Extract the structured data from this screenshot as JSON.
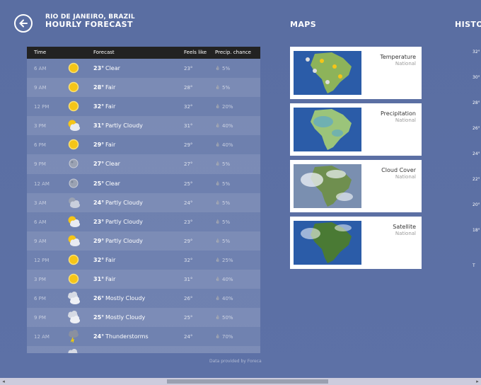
{
  "header": {
    "location": "RIO DE JANEIRO, BRAZIL",
    "title": "HOURLY FORECAST",
    "maps_title": "MAPS",
    "history_title": "HISTOR"
  },
  "table": {
    "columns": [
      "Time",
      "Forecast",
      "Feels like",
      "Precip. chance"
    ],
    "rows": [
      {
        "time": "6 AM",
        "icon": "sun",
        "temp": "23°",
        "cond": "Clear",
        "feels": "23°",
        "precip": "5%"
      },
      {
        "time": "9 AM",
        "icon": "sun",
        "temp": "28°",
        "cond": "Fair",
        "feels": "28°",
        "precip": "5%"
      },
      {
        "time": "12 PM",
        "icon": "sun",
        "temp": "32°",
        "cond": "Fair",
        "feels": "32°",
        "precip": "20%"
      },
      {
        "time": "3 PM",
        "icon": "partly",
        "temp": "31°",
        "cond": "Partly Cloudy",
        "feels": "31°",
        "precip": "40%"
      },
      {
        "time": "6 PM",
        "icon": "sun",
        "temp": "29°",
        "cond": "Fair",
        "feels": "29°",
        "precip": "40%"
      },
      {
        "time": "9 PM",
        "icon": "moon",
        "temp": "27°",
        "cond": "Clear",
        "feels": "27°",
        "precip": "5%"
      },
      {
        "time": "12 AM",
        "icon": "moon",
        "temp": "25°",
        "cond": "Clear",
        "feels": "25°",
        "precip": "5%"
      },
      {
        "time": "3 AM",
        "icon": "moon-cloud",
        "temp": "24°",
        "cond": "Partly Cloudy",
        "feels": "24°",
        "precip": "5%"
      },
      {
        "time": "6 AM",
        "icon": "partly",
        "temp": "23°",
        "cond": "Partly Cloudy",
        "feels": "23°",
        "precip": "5%"
      },
      {
        "time": "9 AM",
        "icon": "partly",
        "temp": "29°",
        "cond": "Partly Cloudy",
        "feels": "29°",
        "precip": "5%"
      },
      {
        "time": "12 PM",
        "icon": "sun",
        "temp": "32°",
        "cond": "Fair",
        "feels": "32°",
        "precip": "25%"
      },
      {
        "time": "3 PM",
        "icon": "sun",
        "temp": "31°",
        "cond": "Fair",
        "feels": "31°",
        "precip": "40%"
      },
      {
        "time": "6 PM",
        "icon": "mostly",
        "temp": "26°",
        "cond": "Mostly Cloudy",
        "feels": "26°",
        "precip": "40%"
      },
      {
        "time": "9 PM",
        "icon": "mostly",
        "temp": "25°",
        "cond": "Mostly Cloudy",
        "feels": "25°",
        "precip": "50%"
      },
      {
        "time": "12 AM",
        "icon": "storm",
        "temp": "24°",
        "cond": "Thunderstorms",
        "feels": "24°",
        "precip": "70%"
      },
      {
        "time": "",
        "icon": "mostly",
        "temp": "",
        "cond": "",
        "feels": "",
        "precip": ""
      }
    ],
    "credit": "Data provided by Foreca"
  },
  "maps": [
    {
      "name": "Temperature",
      "sub": "National",
      "kind": "temperature"
    },
    {
      "name": "Precipitation",
      "sub": "National",
      "kind": "precipitation"
    },
    {
      "name": "Cloud Cover",
      "sub": "National",
      "kind": "cloud"
    },
    {
      "name": "Satellite",
      "sub": "National",
      "kind": "satellite"
    }
  ],
  "history": {
    "labels": [
      "32°",
      "30°",
      "28°",
      "26°",
      "24°",
      "22°",
      "20°",
      "18°",
      "T"
    ]
  },
  "colors": {
    "background": "#5b6fa3",
    "table_header": "#222222",
    "card": "#ffffff",
    "sun": "#f5c518",
    "ocean": "#1e4fa8",
    "land": "#4a8c3a"
  }
}
